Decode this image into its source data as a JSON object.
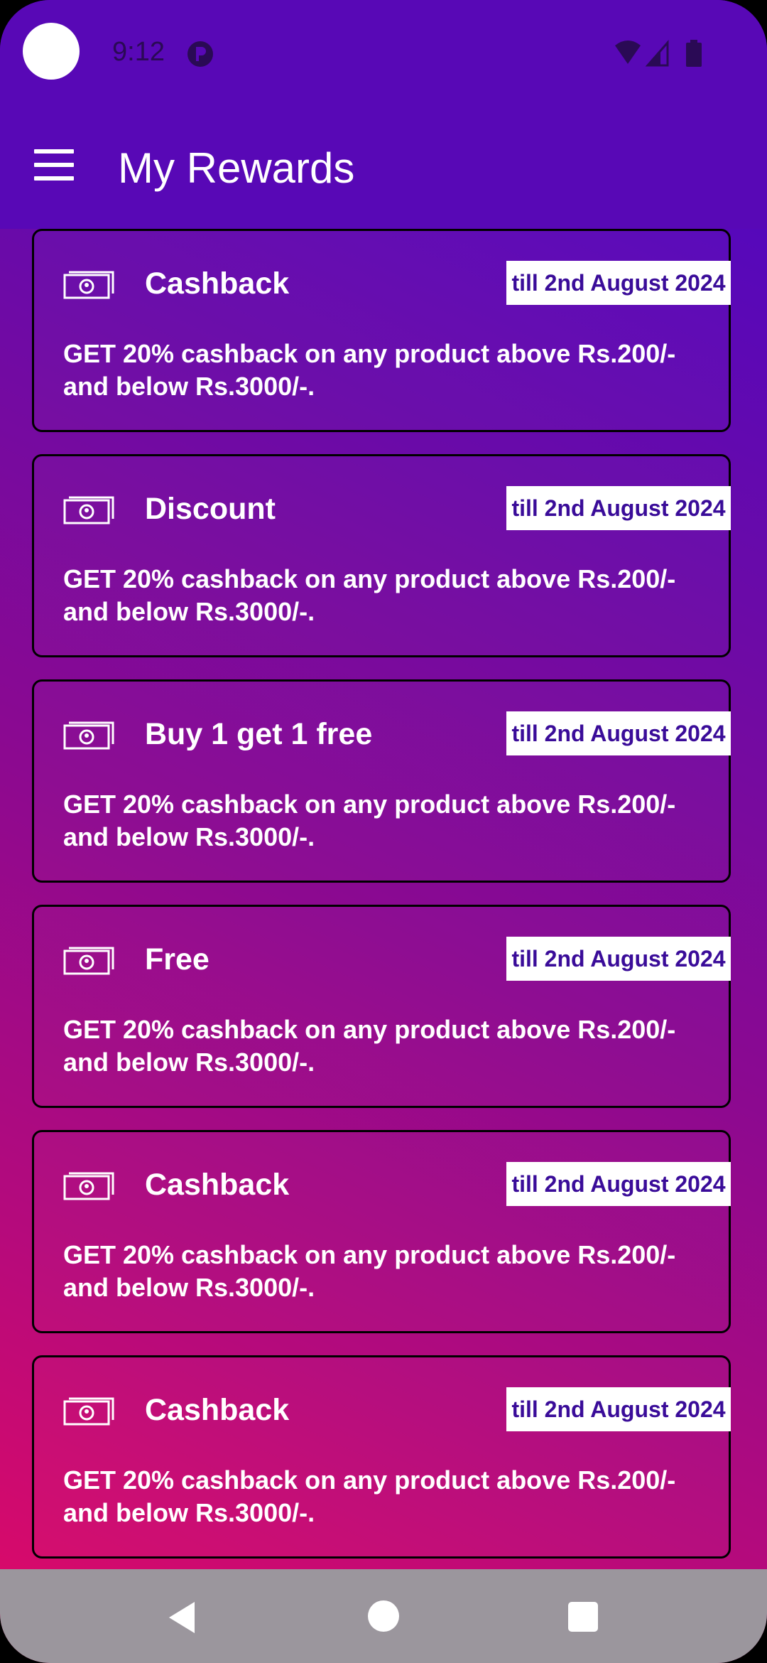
{
  "status_bar": {
    "time": "9:12",
    "icons": [
      "camera-cutout-icon",
      "notification-icon",
      "wifi-icon",
      "signal-icon",
      "battery-icon"
    ]
  },
  "app_bar": {
    "title": "My Rewards",
    "menu_icon": "hamburger-menu-icon"
  },
  "rewards": [
    {
      "title": "Cashback",
      "validity": "till 2nd August 2024",
      "description": "GET 20% cashback on any product above Rs.200/- and below Rs.3000/-."
    },
    {
      "title": "Discount",
      "validity": "till 2nd August 2024",
      "description": "GET 20% cashback on any product above Rs.200/- and below Rs.3000/-."
    },
    {
      "title": "Buy 1 get 1 free",
      "validity": "till 2nd August 2024",
      "description": "GET 20% cashback on any product above Rs.200/- and below Rs.3000/-."
    },
    {
      "title": "Free",
      "validity": "till 2nd August 2024",
      "description": "GET 20% cashback on any product above Rs.200/- and below Rs.3000/-."
    },
    {
      "title": "Cashback",
      "validity": "till 2nd August 2024",
      "description": "GET 20% cashback on any product above Rs.200/- and below Rs.3000/-."
    },
    {
      "title": "Cashback",
      "validity": "till 2nd August 2024",
      "description": "GET 20% cashback on any product above Rs.200/- and below Rs.3000/-."
    }
  ],
  "reward_icon": "money-bill-icon",
  "nav_bar": {
    "icons": [
      "back-icon",
      "home-icon",
      "recents-icon"
    ]
  },
  "colors": {
    "app_bar": "#5808b6",
    "badge_text": "#3a0c99",
    "nav_bar": "#9b969d"
  }
}
